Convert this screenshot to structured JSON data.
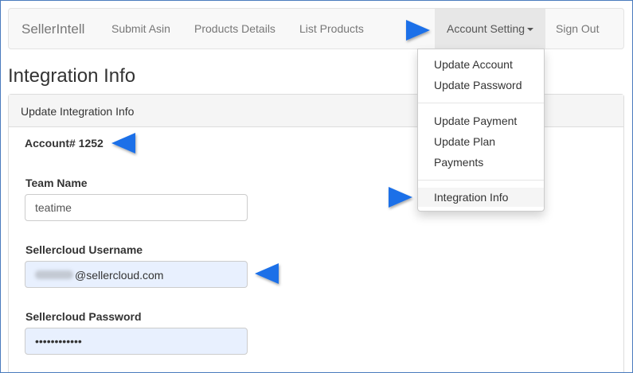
{
  "navbar": {
    "brand": "SellerIntell",
    "links": [
      "Submit Asin",
      "Products Details",
      "List Products"
    ],
    "account_setting": "Account Setting",
    "sign_out": "Sign Out"
  },
  "dropdown": {
    "group1": [
      "Update Account",
      "Update Password"
    ],
    "group2": [
      "Update Payment",
      "Update Plan",
      "Payments"
    ],
    "group3": [
      "Integration Info"
    ]
  },
  "page": {
    "title": "Integration Info",
    "panel_heading": "Update Integration Info",
    "account_number": "Account# 1252"
  },
  "form": {
    "team_name_label": "Team Name",
    "team_name_value": "teatime",
    "username_label": "Sellercloud Username",
    "username_domain": "@sellercloud.com",
    "password_label": "Sellercloud Password",
    "password_mask": "••••••••••••"
  },
  "colors": {
    "arrow": "#1a6fe8",
    "autofill_bg": "#e8f0fe"
  },
  "icons": {
    "annotation": "arrow-icon",
    "caret": "caret-down-icon"
  }
}
